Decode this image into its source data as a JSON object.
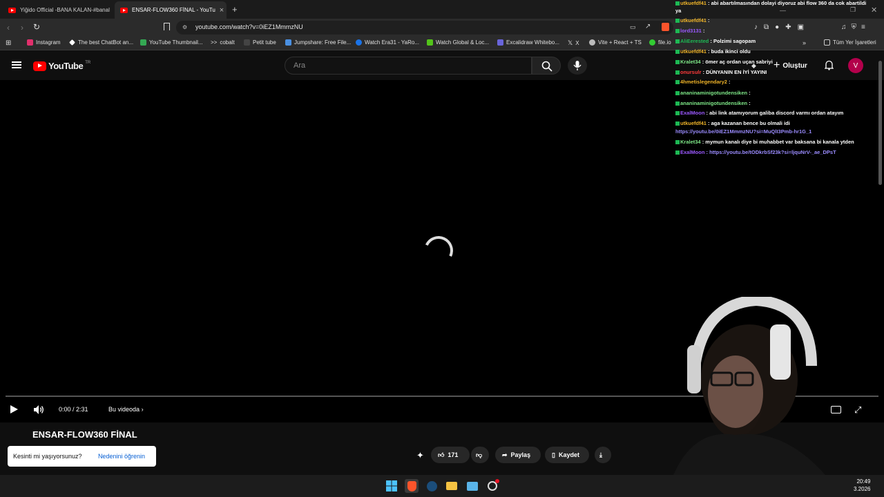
{
  "browser": {
    "tabs": [
      {
        "label": "Yiğido Official -BANA KALAN-#banal",
        "active": false
      },
      {
        "label": "ENSAR-FLOW360 FİNAL - YouTu",
        "active": true
      }
    ],
    "new_tab_icon": "plus-icon",
    "url": "youtube.com/watch?v=0iEZ1MmmzNU",
    "bookmarks": [
      {
        "label": "Instagram",
        "color": "#e1306c"
      },
      {
        "label": "The best ChatBot an...",
        "color": "#ffffff"
      },
      {
        "label": "YouTube Thumbnail...",
        "color": "#34a853"
      },
      {
        "label": "cobalt",
        "color": "#dddddd"
      },
      {
        "label": "Petit tube",
        "color": "#444444"
      },
      {
        "label": "Jumpshare: Free File...",
        "color": "#4a90e2"
      },
      {
        "label": "Watch Era31 - YaRo...",
        "color": "#1a73e8"
      },
      {
        "label": "Watch Global & Loc...",
        "color": "#53c41a"
      },
      {
        "label": "Excalidraw Whitebo...",
        "color": "#6965db"
      },
      {
        "label": "X",
        "color": "#000000"
      },
      {
        "label": "Vite + React + TS",
        "color": "#bbbbbb"
      },
      {
        "label": "file.io",
        "color": "#33cc33"
      }
    ],
    "all_bookmarks": "Tüm Yer İşaretleri"
  },
  "youtube": {
    "logo": "YouTube",
    "region": "TR",
    "search_placeholder": "Ara",
    "create_label": "Oluştur",
    "avatar_letter": "V"
  },
  "player": {
    "time": "0:00 / 2:31",
    "chapter": "Bu videoda",
    "progress": 0
  },
  "video": {
    "title": "ENSAR-FLOW360 FİNAL",
    "likes": "171",
    "share": "Paylaş",
    "save": "Kaydet"
  },
  "toast": {
    "message": "Kesinti mi yaşıyorsunuz?",
    "link": "Nedenini öğrenin"
  },
  "clock": {
    "time": "20:49",
    "date": "3.2026"
  },
  "chat": [
    {
      "user": "utkuefdf41",
      "color": "#f0b429",
      "text": ": abi abartılmasından dolayi diyoruz abi flow 360 da cok abartildi"
    },
    {
      "user": "",
      "color": "#ffffff",
      "text": "ya"
    },
    {
      "user": "utkuefdf41",
      "color": "#f0b429",
      "text": ":"
    },
    {
      "user": "lord3131",
      "color": "#9b59ff",
      "text": ":"
    },
    {
      "user": "AliEerested",
      "color": "#1db954",
      "text": ": Polzimi sagopam"
    },
    {
      "user": "utkuefdf41",
      "color": "#f0b429",
      "text": ": buda ikinci oldu"
    },
    {
      "user": "Kralet34",
      "color": "#7ee787",
      "text": ": ömer aç ordan uçan sabriyi"
    },
    {
      "user": "onursulr",
      "color": "#ff3b3b",
      "text": ": DÜNYANIN EN İYİ YAYINI"
    },
    {
      "user": "4hmetislegendary2",
      "color": "#f0b429",
      "text": ":"
    },
    {
      "user": "ananinaminigotundensiken",
      "color": "#7ee787",
      "text": ":"
    },
    {
      "user": "ananinaminigotundensiken",
      "color": "#7ee787",
      "text": ":"
    },
    {
      "user": "ExalMoon",
      "color": "#9b59ff",
      "text": ": abi link atamıyorum galiba discord varmı ordan atayım"
    },
    {
      "user": "utkuefdf41",
      "color": "#f0b429",
      "text": ": aga kazanan bence bu olmali idi"
    },
    {
      "user": "",
      "color": "#9b59ff",
      "text": "https://youtu.be/0iEZ1MmmzNU?si=MuQlI3Pmb-hr1G_1"
    },
    {
      "user": "Kralet34",
      "color": "#7ee787",
      "text": ": mymun kanalı diye bi muhabbet var baksana bi kanala ytden"
    },
    {
      "user": "ExalMoon",
      "color": "#9b59ff",
      "text": ": https://youtu.be/tODkrbSf23k?si=ljquNrV-_ae_DPsT"
    }
  ]
}
